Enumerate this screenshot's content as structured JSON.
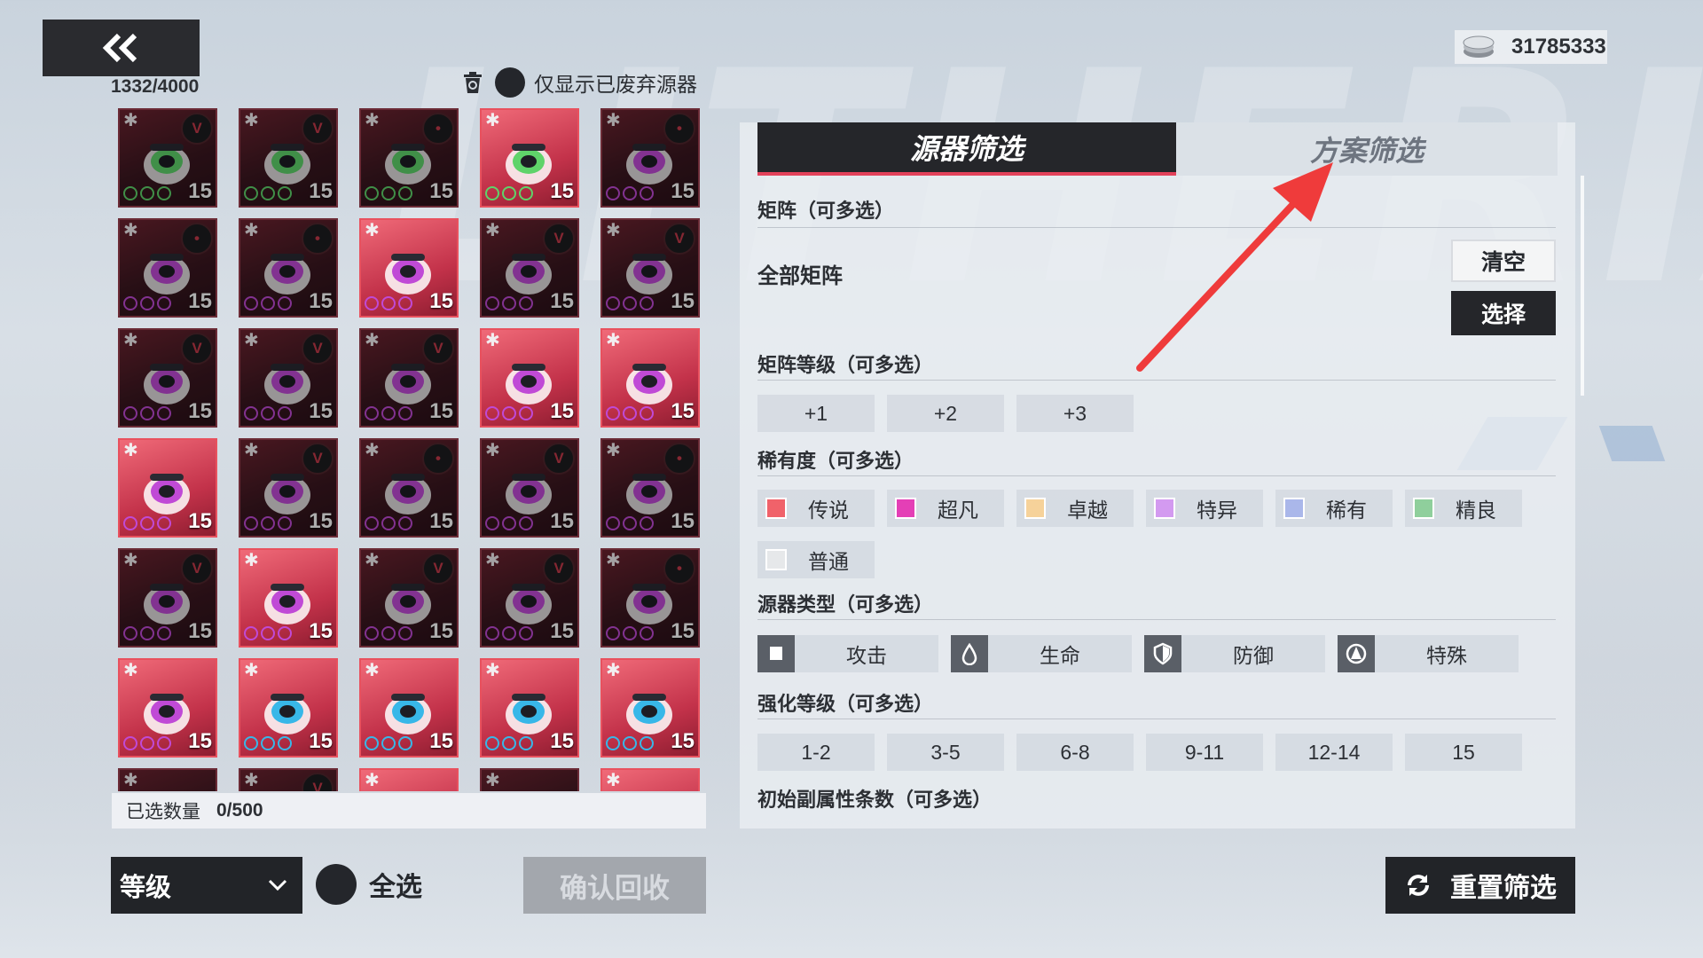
{
  "header": {
    "capacity": "1332/4000",
    "discard_filter_label": "仅显示已废弃源器",
    "currency_amount": "31785333"
  },
  "tiles": [
    {
      "lvl": "15",
      "icon": "green",
      "hi": false,
      "badge": "V"
    },
    {
      "lvl": "15",
      "icon": "green",
      "hi": false,
      "badge": "V"
    },
    {
      "lvl": "15",
      "icon": "green",
      "hi": false,
      "badge": "•"
    },
    {
      "lvl": "15",
      "icon": "green",
      "hi": true,
      "badge": ""
    },
    {
      "lvl": "15",
      "icon": "purple",
      "hi": false,
      "badge": "•"
    },
    {
      "lvl": "15",
      "icon": "purple",
      "hi": false,
      "badge": "•"
    },
    {
      "lvl": "15",
      "icon": "purple",
      "hi": false,
      "badge": "•"
    },
    {
      "lvl": "15",
      "icon": "purple",
      "hi": true,
      "badge": ""
    },
    {
      "lvl": "15",
      "icon": "purple",
      "hi": false,
      "badge": "V"
    },
    {
      "lvl": "15",
      "icon": "purple",
      "hi": false,
      "badge": "V"
    },
    {
      "lvl": "15",
      "icon": "purple",
      "hi": false,
      "badge": "V"
    },
    {
      "lvl": "15",
      "icon": "purple",
      "hi": false,
      "badge": "V"
    },
    {
      "lvl": "15",
      "icon": "purple",
      "hi": false,
      "badge": "V"
    },
    {
      "lvl": "15",
      "icon": "purple",
      "hi": true,
      "badge": ""
    },
    {
      "lvl": "15",
      "icon": "purple",
      "hi": true,
      "badge": ""
    },
    {
      "lvl": "15",
      "icon": "purple",
      "hi": true,
      "badge": ""
    },
    {
      "lvl": "15",
      "icon": "purple",
      "hi": false,
      "badge": "V"
    },
    {
      "lvl": "15",
      "icon": "purple",
      "hi": false,
      "badge": "•"
    },
    {
      "lvl": "15",
      "icon": "purple",
      "hi": false,
      "badge": "V"
    },
    {
      "lvl": "15",
      "icon": "purple",
      "hi": false,
      "badge": "•"
    },
    {
      "lvl": "15",
      "icon": "purple",
      "hi": false,
      "badge": "V"
    },
    {
      "lvl": "15",
      "icon": "purple",
      "hi": true,
      "badge": ""
    },
    {
      "lvl": "15",
      "icon": "purple",
      "hi": false,
      "badge": "V"
    },
    {
      "lvl": "15",
      "icon": "purple",
      "hi": false,
      "badge": "V"
    },
    {
      "lvl": "15",
      "icon": "purple",
      "hi": false,
      "badge": "•"
    },
    {
      "lvl": "15",
      "icon": "purple",
      "hi": true,
      "badge": ""
    },
    {
      "lvl": "15",
      "icon": "blue",
      "hi": true,
      "badge": ""
    },
    {
      "lvl": "15",
      "icon": "blue",
      "hi": true,
      "badge": ""
    },
    {
      "lvl": "15",
      "icon": "blue",
      "hi": true,
      "badge": ""
    },
    {
      "lvl": "15",
      "icon": "blue",
      "hi": true,
      "badge": ""
    },
    {
      "lvl": "",
      "icon": "purple",
      "hi": false,
      "badge": ""
    },
    {
      "lvl": "",
      "icon": "purple",
      "hi": false,
      "badge": "V"
    },
    {
      "lvl": "",
      "icon": "purple",
      "hi": true,
      "badge": ""
    },
    {
      "lvl": "",
      "icon": "purple",
      "hi": false,
      "badge": ""
    },
    {
      "lvl": "",
      "icon": "purple",
      "hi": true,
      "badge": ""
    }
  ],
  "selection": {
    "label": "已选数量",
    "count": "0/500"
  },
  "controls": {
    "sort_label": "等级",
    "select_all_label": "全选",
    "confirm_label": "确认回收",
    "reset_label": "重置筛选"
  },
  "filter": {
    "tabs": [
      {
        "label": "源器筛选"
      },
      {
        "label": "方案筛选"
      }
    ],
    "matrix_title": "矩阵（可多选）",
    "matrix_value": "全部矩阵",
    "clear_label": "清空",
    "select_label": "选择",
    "matrix_level_title": "矩阵等级（可多选）",
    "matrix_levels": [
      "+1",
      "+2",
      "+3"
    ],
    "rarity_title": "稀有度（可多选）",
    "rarities": [
      {
        "label": "传说",
        "color": "#f0626a"
      },
      {
        "label": "超凡",
        "color": "#e43fb6"
      },
      {
        "label": "卓越",
        "color": "#f6d29a"
      },
      {
        "label": "特异",
        "color": "#d39af0"
      },
      {
        "label": "稀有",
        "color": "#aab7ea"
      },
      {
        "label": "精良",
        "color": "#8fcf9c"
      },
      {
        "label": "普通",
        "color": "#e6e8ea"
      }
    ],
    "type_title": "源器类型（可多选）",
    "types": [
      {
        "label": "攻击",
        "icon": "fist-icon"
      },
      {
        "label": "生命",
        "icon": "drop-icon"
      },
      {
        "label": "防御",
        "icon": "shield-icon"
      },
      {
        "label": "特殊",
        "icon": "star-emblem-icon"
      }
    ],
    "enhance_title": "强化等级（可多选）",
    "enhance_levels": [
      "1-2",
      "3-5",
      "6-8",
      "9-11",
      "12-14",
      "15"
    ],
    "substat_title": "初始副属性条数（可多选）"
  }
}
